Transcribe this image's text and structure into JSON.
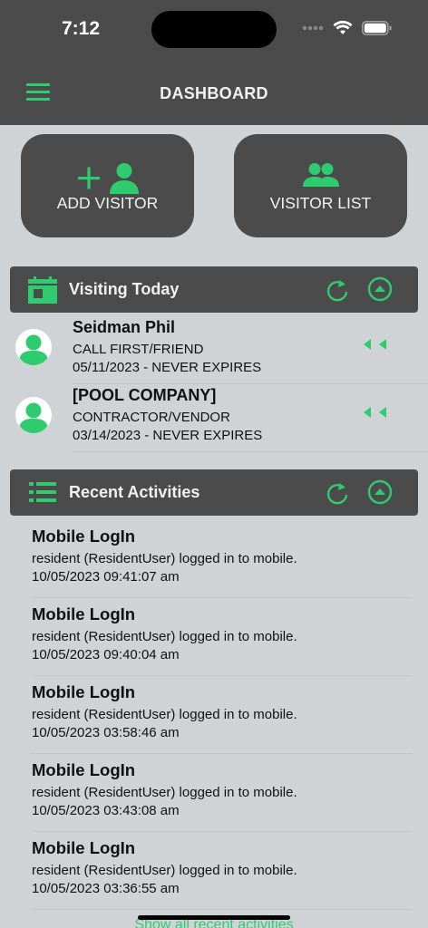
{
  "status_bar": {
    "time": "7:12"
  },
  "header": {
    "title": "DASHBOARD",
    "menu_icon": "hamburger-icon"
  },
  "actions": {
    "add_visitor": "ADD VISITOR",
    "visitor_list": "VISITOR LIST"
  },
  "visiting_today": {
    "title": "Visiting Today",
    "visitors": [
      {
        "name": "Seidman Phil",
        "type": "CALL FIRST/FRIEND",
        "date": "05/11/2023 - NEVER EXPIRES"
      },
      {
        "name": "[POOL COMPANY]",
        "type": "CONTRACTOR/VENDOR",
        "date": "03/14/2023 - NEVER EXPIRES"
      }
    ]
  },
  "recent_activities": {
    "title": "Recent Activities",
    "items": [
      {
        "title": "Mobile LogIn",
        "desc": "resident (ResidentUser) logged in to mobile.",
        "time": "10/05/2023 09:41:07 am"
      },
      {
        "title": "Mobile LogIn",
        "desc": "resident (ResidentUser) logged in to mobile.",
        "time": "10/05/2023 09:40:04 am"
      },
      {
        "title": "Mobile LogIn",
        "desc": "resident (ResidentUser) logged in to mobile.",
        "time": "10/05/2023 03:58:46 am"
      },
      {
        "title": "Mobile LogIn",
        "desc": "resident (ResidentUser) logged in to mobile.",
        "time": "10/05/2023 03:43:08 am"
      },
      {
        "title": "Mobile LogIn",
        "desc": "resident (ResidentUser) logged in to mobile.",
        "time": "10/05/2023 03:36:55 am"
      }
    ],
    "show_all": "Show all recent activities"
  },
  "colors": {
    "accent": "#2fcc6f",
    "bar": "#4b4b4b",
    "background": "#cfd3d6"
  }
}
